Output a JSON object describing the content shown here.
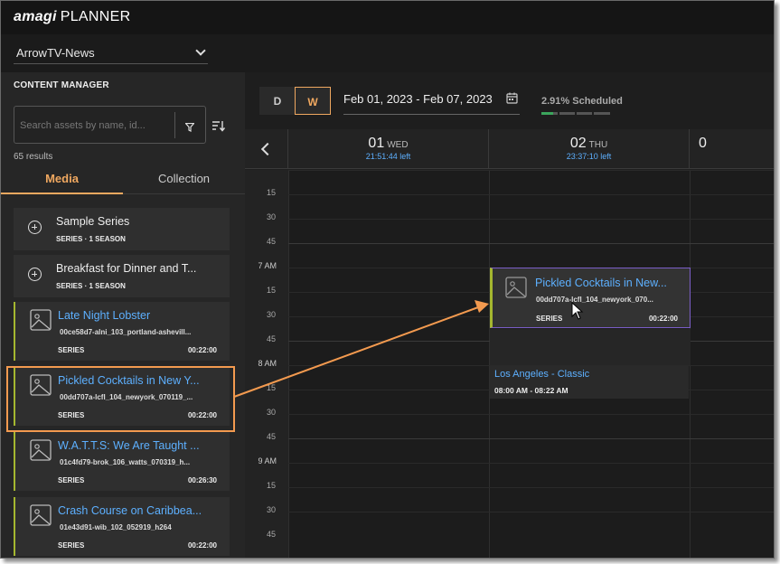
{
  "app": {
    "logo_brand": "amagi",
    "logo_product": "PLANNER"
  },
  "channel": {
    "selected": "ArrowTV-News"
  },
  "content_manager": {
    "title": "CONTENT MANAGER",
    "search_placeholder": "Search assets by name, id...",
    "results": "65 results",
    "tabs": [
      {
        "label": "Media",
        "active": true
      },
      {
        "label": "Collection",
        "active": false
      }
    ],
    "items": [
      {
        "type": "series",
        "title": "Sample Series",
        "meta1": "SERIES",
        "meta2": "1 SEASON",
        "icon": "plus-circle-icon"
      },
      {
        "type": "series",
        "title": "Breakfast for Dinner and T...",
        "meta1": "SERIES",
        "meta2": "1 SEASON",
        "icon": "plus-circle-icon"
      },
      {
        "type": "asset",
        "title": "Late Night Lobster",
        "file": "00ce58d7-alni_103_portland-ashevill...",
        "kind": "SERIES",
        "duration": "00:22:00",
        "icon": "image-icon"
      },
      {
        "type": "asset",
        "title": "Pickled Cocktails in New Y...",
        "file": "00dd707a-lcfl_104_newyork_070119_...",
        "kind": "SERIES",
        "duration": "00:22:00",
        "icon": "image-icon"
      },
      {
        "type": "asset",
        "title": "W.A.T.T.S: We Are Taught ...",
        "file": "01c4fd79-brok_106_watts_070319_h...",
        "kind": "SERIES",
        "duration": "00:26:30",
        "icon": "image-icon"
      },
      {
        "type": "asset",
        "title": "Crash Course on Caribbea...",
        "file": "01e43d91-wib_102_052919_h264",
        "kind": "SERIES",
        "duration": "00:22:00",
        "icon": "image-icon"
      }
    ]
  },
  "planner": {
    "view_buttons": {
      "day": "D",
      "week": "W",
      "active": "W"
    },
    "date_range": "Feb 01, 2023 - Feb 07, 2023",
    "scheduled": "2.91% Scheduled",
    "scheduled_fraction": 0.0291,
    "days": [
      {
        "num": "01",
        "dow": "WED",
        "left": "21:51:44 left"
      },
      {
        "num": "02",
        "dow": "THU",
        "left": "23:37:10 left"
      },
      {
        "num": "0"
      }
    ],
    "time_labels": [
      "15",
      "30",
      "45",
      "7 AM",
      "15",
      "30",
      "45",
      "8 AM",
      "15",
      "30",
      "45",
      "9 AM",
      "15",
      "30",
      "45"
    ],
    "events": {
      "dragged": {
        "title": "Pickled Cocktails in New...",
        "file": "00dd707a-lcfl_104_newyork_070...",
        "kind": "SERIES",
        "duration": "00:22:00"
      },
      "scheduled": {
        "title": "Los Angeles - Classic",
        "time": "08:00 AM - 08:22 AM"
      }
    }
  },
  "colors": {
    "accent": "#f0a860",
    "link": "#5db0ff",
    "asset_bar": "#a5b72f",
    "annotation": "#f39a4f",
    "drag_border": "#7b5ec8"
  }
}
